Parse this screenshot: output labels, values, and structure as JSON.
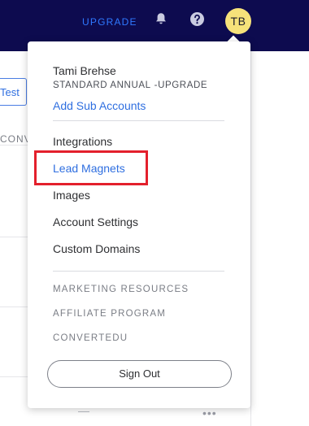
{
  "topbar": {
    "upgrade_label": "UPGRADE",
    "avatar_initials": "TB",
    "icons": [
      "bell-icon",
      "help-icon"
    ],
    "background_color": "#0d0b4f",
    "avatar_color": "#f6e27a"
  },
  "background_page": {
    "tab_label": "Test",
    "column_label": "CONV"
  },
  "menu": {
    "user_name": "Tami Brehse",
    "plan_name": "STANDARD ANNUAL",
    "plan_separator": "-",
    "plan_upgrade": "UPGRADE",
    "add_sub_accounts": "Add Sub Accounts",
    "items": [
      {
        "label": "Integrations"
      },
      {
        "label": "Lead Magnets",
        "active": true,
        "highlighted": true
      },
      {
        "label": "Images"
      },
      {
        "label": "Account Settings"
      },
      {
        "label": "Custom Domains"
      }
    ],
    "resources": [
      {
        "label": "MARKETING RESOURCES"
      },
      {
        "label": "AFFILIATE PROGRAM"
      },
      {
        "label": "CONVERTEDU"
      }
    ],
    "sign_out_label": "Sign Out",
    "link_color": "#2f6fe0",
    "highlight_color": "#e3202c"
  }
}
